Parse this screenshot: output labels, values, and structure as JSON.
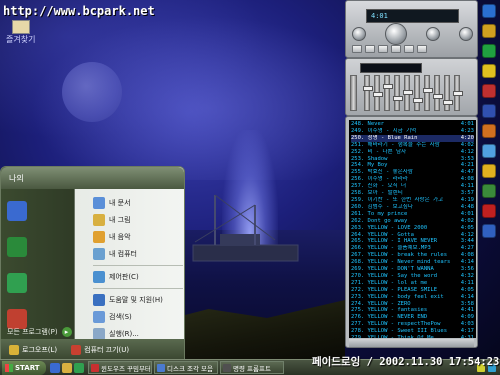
{
  "desktop": {
    "watermark": "http://www.bcpark.net",
    "corner_icon_label": "즐겨찾기"
  },
  "start_menu": {
    "user_label": "나의",
    "right_items": [
      {
        "label": "내 문서",
        "icon": "documents-icon",
        "color": "#5a8fd8"
      },
      {
        "label": "내 그림",
        "icon": "pictures-icon",
        "color": "#d8b040"
      },
      {
        "label": "내 음악",
        "icon": "music-icon",
        "color": "#e0a030"
      },
      {
        "label": "내 컴퓨터",
        "icon": "computer-icon",
        "color": "#6aa0d0"
      }
    ],
    "right_items_2": [
      {
        "label": "제어판(C)",
        "icon": "control-panel-icon",
        "color": "#4a90d0"
      }
    ],
    "right_items_3": [
      {
        "label": "도움말 및 지원(H)",
        "icon": "help-icon",
        "color": "#3a70c0"
      },
      {
        "label": "검색(S)",
        "icon": "search-icon",
        "color": "#6a9ad8"
      },
      {
        "label": "실행(R)...",
        "icon": "run-icon",
        "color": "#8aa8c8"
      }
    ],
    "all_programs": "모든 프로그램(P)",
    "logoff": "로그오프(L)",
    "shutdown": "컴퓨터 끄기(U)",
    "pinned_colors": [
      "#3a6ad0",
      "#2a8a3a",
      "#30a050",
      "#c04030"
    ]
  },
  "taskbar": {
    "start_label": "START",
    "tasks": [
      {
        "label": "윈도우즈 꾸밈부터",
        "color": "#c83030"
      },
      {
        "label": "디스크 조각 모음",
        "color": "#4a7ad0"
      },
      {
        "label": "명령 프롬프트",
        "color": "#505050"
      }
    ],
    "clock_overlay": "페이드로잉 / 2002.11.30 17:54:23"
  },
  "winamp": {
    "display_text": "4:01",
    "playlist": [
      {
        "n": "248.",
        "title": "Never",
        "time": "4:01"
      },
      {
        "n": "249.",
        "title": "이수영 - 지금 기억",
        "time": "4:23"
      },
      {
        "n": "250.",
        "title": "청명 - Blue Rain",
        "time": "4:20"
      },
      {
        "n": "251.",
        "title": "해바라기 - 행복을 주는 사람",
        "time": "4:02"
      },
      {
        "n": "252.",
        "title": "비 - 나쁜 남자",
        "time": "4:12"
      },
      {
        "n": "253.",
        "title": "Shadow",
        "time": "3:53"
      },
      {
        "n": "254.",
        "title": "My Boy",
        "time": "4:21"
      },
      {
        "n": "255.",
        "title": "박효신 - 좋은사람",
        "time": "4:47"
      },
      {
        "n": "256.",
        "title": "이수영 - 라라라",
        "time": "4:08"
      },
      {
        "n": "257.",
        "title": "신화 - 오직 너",
        "time": "4:11"
      },
      {
        "n": "258.",
        "title": "보아 - 발렌티",
        "time": "3:57"
      },
      {
        "n": "259.",
        "title": "이기찬 - 또 한번 사랑은 가고",
        "time": "4:19"
      },
      {
        "n": "260.",
        "title": "김범수 - 보고싶다",
        "time": "4:48"
      },
      {
        "n": "261.",
        "title": "To my prince",
        "time": "4:01"
      },
      {
        "n": "262.",
        "title": "Dont go away",
        "time": "4:02"
      },
      {
        "n": "263.",
        "title": "YELLOW - LOVE 2000",
        "time": "4:05"
      },
      {
        "n": "264.",
        "title": "YELLOW - Gotta",
        "time": "4:12"
      },
      {
        "n": "265.",
        "title": "YELLOW - I HAVE NEVER",
        "time": "3:44"
      },
      {
        "n": "266.",
        "title": "YELLOW - 슬픔예보.MP3",
        "time": "4:27"
      },
      {
        "n": "267.",
        "title": "YELLOW - break the rules",
        "time": "4:08"
      },
      {
        "n": "268.",
        "title": "YELLOW - Never mind tears",
        "time": "4:14"
      },
      {
        "n": "269.",
        "title": "YELLOW - DON'T WANNA",
        "time": "3:56"
      },
      {
        "n": "270.",
        "title": "YELLOW - Say the word",
        "time": "4:32"
      },
      {
        "n": "271.",
        "title": "YELLOW - lol at me",
        "time": "4:11"
      },
      {
        "n": "272.",
        "title": "YELLOW - PLEASE SMILE",
        "time": "4:05"
      },
      {
        "n": "273.",
        "title": "YELLOW - body feel exit",
        "time": "4:14"
      },
      {
        "n": "274.",
        "title": "YELLOW - ZERO",
        "time": "3:58"
      },
      {
        "n": "275.",
        "title": "YELLOW - fantasies",
        "time": "4:41"
      },
      {
        "n": "276.",
        "title": "YELLOW - NEVER END",
        "time": "4:09"
      },
      {
        "n": "277.",
        "title": "YELLOW - respectThePow",
        "time": "4:03"
      },
      {
        "n": "278.",
        "title": "YELLOW - Sweet III Blues",
        "time": "4:17"
      },
      {
        "n": "279.",
        "title": "YELLOW - Think Of Me",
        "time": "4:31"
      },
      {
        "n": "280.",
        "title": "YELLOW - Stay",
        "time": "4:22"
      },
      {
        "n": "281.",
        "title": "YELLOW - Blue water",
        "time": "4:02"
      },
      {
        "n": "282.",
        "title": "YELLOW - How To Be A Gift",
        "time": "4:38"
      },
      {
        "n": "283.",
        "title": "YELLOW - My Boy",
        "time": "4:03"
      }
    ],
    "active_index": 2
  },
  "quick_column": [
    "#2a6fd0",
    "#d0a020",
    "#20a040",
    "#e0c020",
    "#c03030",
    "#3050b0",
    "#d07020",
    "#50a0e0",
    "#e0b020",
    "#3a8a3a",
    "#c02020",
    "#3060c0"
  ]
}
